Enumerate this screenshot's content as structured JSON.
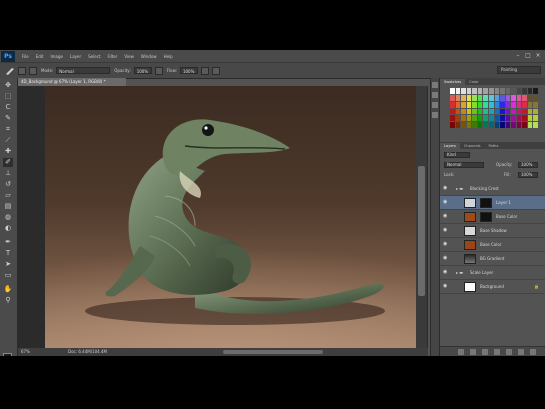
{
  "app": {
    "logo": "Ps",
    "menu": [
      "File",
      "Edit",
      "Image",
      "Layer",
      "Select",
      "Filter",
      "View",
      "Window",
      "Help"
    ],
    "window_controls": {
      "minimize": "–",
      "maximize": "□",
      "close": "×"
    }
  },
  "options_bar": {
    "mode_label": "Mode:",
    "mode_value": "Normal",
    "opacity_label": "Opacity:",
    "opacity_value": "100%",
    "flow_label": "Flow:",
    "flow_value": "100%",
    "workspace": "Painting"
  },
  "document": {
    "tab_title": "4D_Background @ 67% (Layer 1, RGB/8) *",
    "zoom": "67%",
    "doc_size": "Doc: 6.44M/104.4M"
  },
  "layers_panel": {
    "tabs": [
      "Layers",
      "Channels",
      "Paths"
    ],
    "kind_label": "Kind",
    "blend_mode": "Normal",
    "opacity_label": "Opacity:",
    "opacity_value": "100%",
    "lock_label": "Lock:",
    "fill_label": "Fill:",
    "fill_value": "100%",
    "rows": [
      {
        "name": "Blocking Crest",
        "kind": "group"
      },
      {
        "name": "Layer 1",
        "kind": "layer",
        "selected": true
      },
      {
        "name": "Base Color",
        "kind": "layer"
      },
      {
        "name": "Base Shadow",
        "kind": "layer"
      },
      {
        "name": "Base Color",
        "kind": "layer"
      },
      {
        "name": "BG Gradient",
        "kind": "layer"
      },
      {
        "name": "Scale Layer",
        "kind": "group"
      },
      {
        "name": "Background",
        "kind": "layer"
      }
    ]
  },
  "swatches_panel": {
    "tabs": [
      "Swatches",
      "Color"
    ]
  },
  "colors": {
    "foreground": "#1b1e1a",
    "background": "#3f8a4a",
    "selection": "#5b6e89"
  },
  "icons": [
    "move-icon",
    "marquee-icon",
    "lasso-icon",
    "quick-select-icon",
    "crop-icon",
    "eyedropper-icon",
    "healing-icon",
    "brush-icon",
    "clone-stamp-icon",
    "history-brush-icon",
    "eraser-icon",
    "gradient-icon",
    "blur-icon",
    "dodge-icon",
    "pen-icon",
    "type-icon",
    "path-select-icon",
    "shape-icon",
    "hand-icon",
    "zoom-icon"
  ]
}
